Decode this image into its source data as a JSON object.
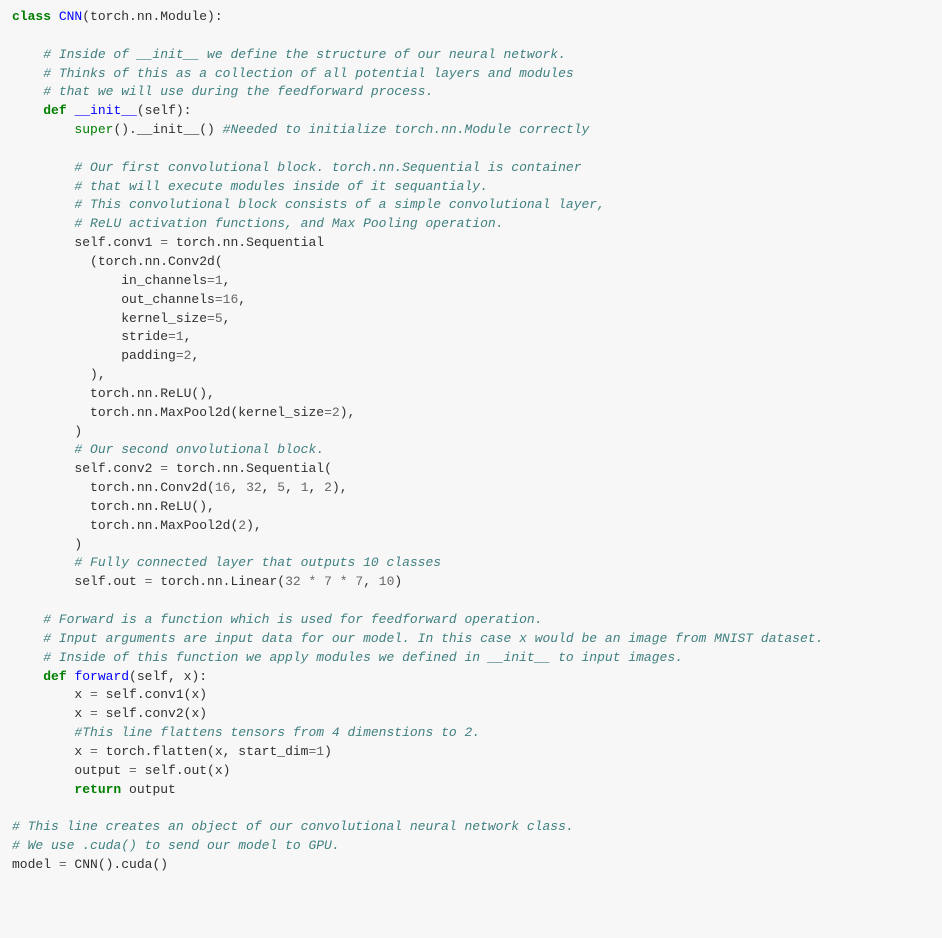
{
  "code": {
    "l1_kw": "class",
    "l1_cls": "CNN",
    "l1_rest": "(torch.nn.Module):",
    "l3_cm": "# Inside of __init__ we define the structure of our neural network.",
    "l4_cm": "# Thinks of this as a collection of all potential layers and modules",
    "l5_cm": "# that we will use during the feedforward process.",
    "l6_kw": "def",
    "l6_fn": "__init__",
    "l6_rest": "(self):",
    "l7_super": "super",
    "l7_init": "().__init__()",
    "l7_cm": "#Needed to initialize torch.nn.Module correctly",
    "l9_cm": "# Our first convolutional block. torch.nn.Sequential is container",
    "l10_cm": "# that will execute modules inside of it sequantialy.",
    "l11_cm": "# This convolutional block consists of a simple convolutional layer,",
    "l12_cm": "# ReLU activation functions, and Max Pooling operation.",
    "l13a": "self.conv1 ",
    "l13b": "=",
    "l13c": " torch.nn.Sequential",
    "l14": "(torch.nn.Conv2d(",
    "l15a": "in_channels",
    "l15b": "=",
    "l15c": "1",
    "l15d": ",",
    "l16a": "out_channels",
    "l16b": "=",
    "l16c": "16",
    "l16d": ",",
    "l17a": "kernel_size",
    "l17b": "=",
    "l17c": "5",
    "l17d": ",",
    "l18a": "stride",
    "l18b": "=",
    "l18c": "1",
    "l18d": ",",
    "l19a": "padding",
    "l19b": "=",
    "l19c": "2",
    "l19d": ",",
    "l20": "),",
    "l21": "torch.nn.ReLU(),",
    "l22a": "torch.nn.MaxPool2d(kernel_size",
    "l22b": "=",
    "l22c": "2",
    "l22d": "),",
    "l23": ")",
    "l24_cm": "# Our second onvolutional block.",
    "l25a": "self.conv2 ",
    "l25b": "=",
    "l25c": " torch.nn.Sequential(",
    "l26a": "torch.nn.Conv2d(",
    "l26b": "16",
    "l26c": ", ",
    "l26d": "32",
    "l26e": ", ",
    "l26f": "5",
    "l26g": ", ",
    "l26h": "1",
    "l26i": ", ",
    "l26j": "2",
    "l26k": "),",
    "l27": "torch.nn.ReLU(),",
    "l28a": "torch.nn.MaxPool2d(",
    "l28b": "2",
    "l28c": "),",
    "l29": ")",
    "l30_cm": "# Fully connected layer that outputs 10 classes",
    "l31a": "self.out ",
    "l31b": "=",
    "l31c": " torch.nn.Linear(",
    "l31d": "32",
    "l31e": " ",
    "l31f": "*",
    "l31g": " ",
    "l31h": "7",
    "l31i": " ",
    "l31j": "*",
    "l31k": " ",
    "l31l": "7",
    "l31m": ", ",
    "l31n": "10",
    "l31o": ")",
    "l33_cm": "# Forward is a function which is used for feedforward operation.",
    "l34_cm": "# Input arguments are input data for our model. In this case x would be an image from MNIST dataset.",
    "l35_cm": "# Inside of this function we apply modules we defined in __init__ to input images.",
    "l36_kw": "def",
    "l36_fn": "forward",
    "l36_rest": "(self, x):",
    "l37a": "x ",
    "l37b": "=",
    "l37c": " self.conv1(x)",
    "l38a": "x ",
    "l38b": "=",
    "l38c": " self.conv2(x)",
    "l39_cm": "#This line flattens tensors from 4 dimenstions to 2.",
    "l40a": "x ",
    "l40b": "=",
    "l40c": " torch.flatten(x, start_dim",
    "l40d": "=",
    "l40e": "1",
    "l40f": ")",
    "l41a": "output ",
    "l41b": "=",
    "l41c": " self.out(x)",
    "l42_kw": "return",
    "l42_rest": " output",
    "l44_cm": "# This line creates an object of our convolutional neural network class.",
    "l45_cm": "# We use .cuda() to send our model to GPU.",
    "l46a": "model ",
    "l46b": "=",
    "l46c": " CNN().cuda()"
  }
}
